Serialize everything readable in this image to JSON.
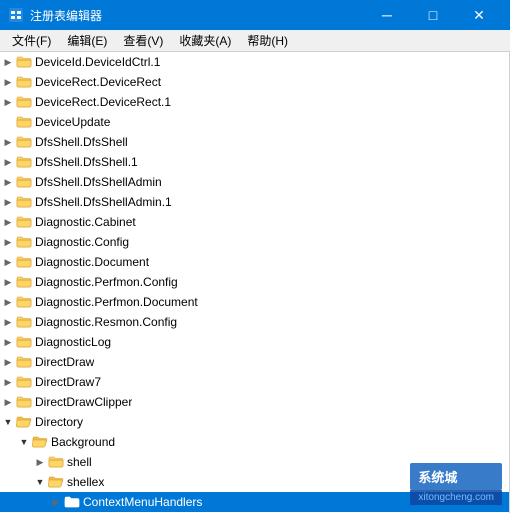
{
  "titleBar": {
    "title": "注册表编辑器",
    "icon": "regedit",
    "controls": [
      "minimize",
      "maximize",
      "close"
    ]
  },
  "menuBar": {
    "items": [
      {
        "id": "file",
        "label": "文件(F)"
      },
      {
        "id": "edit",
        "label": "编辑(E)"
      },
      {
        "id": "view",
        "label": "查看(V)"
      },
      {
        "id": "favorites",
        "label": "收藏夹(A)"
      },
      {
        "id": "help",
        "label": "帮助(H)"
      }
    ]
  },
  "tree": {
    "items": [
      {
        "id": "1",
        "label": "DeviceId.DeviceIdCtrl.1",
        "indent": 1,
        "expanded": false,
        "open": false
      },
      {
        "id": "2",
        "label": "DeviceRect.DeviceRect",
        "indent": 1,
        "expanded": false,
        "open": false
      },
      {
        "id": "3",
        "label": "DeviceRect.DeviceRect.1",
        "indent": 1,
        "expanded": false,
        "open": false
      },
      {
        "id": "4",
        "label": "DeviceUpdate",
        "indent": 1,
        "expanded": false,
        "open": false,
        "noExpand": true
      },
      {
        "id": "5",
        "label": "DfsShell.DfsShell",
        "indent": 1,
        "expanded": false,
        "open": false
      },
      {
        "id": "6",
        "label": "DfsShell.DfsShell.1",
        "indent": 1,
        "expanded": false,
        "open": false
      },
      {
        "id": "7",
        "label": "DfsShell.DfsShellAdmin",
        "indent": 1,
        "expanded": false,
        "open": false
      },
      {
        "id": "8",
        "label": "DfsShell.DfsShellAdmin.1",
        "indent": 1,
        "expanded": false,
        "open": false
      },
      {
        "id": "9",
        "label": "Diagnostic.Cabinet",
        "indent": 1,
        "expanded": false,
        "open": false
      },
      {
        "id": "10",
        "label": "Diagnostic.Config",
        "indent": 1,
        "expanded": false,
        "open": false
      },
      {
        "id": "11",
        "label": "Diagnostic.Document",
        "indent": 1,
        "expanded": false,
        "open": false
      },
      {
        "id": "12",
        "label": "Diagnostic.Perfmon.Config",
        "indent": 1,
        "expanded": false,
        "open": false
      },
      {
        "id": "13",
        "label": "Diagnostic.Perfmon.Document",
        "indent": 1,
        "expanded": false,
        "open": false
      },
      {
        "id": "14",
        "label": "Diagnostic.Resmon.Config",
        "indent": 1,
        "expanded": false,
        "open": false
      },
      {
        "id": "15",
        "label": "DiagnosticLog",
        "indent": 1,
        "expanded": false,
        "open": false
      },
      {
        "id": "16",
        "label": "DirectDraw",
        "indent": 1,
        "expanded": false,
        "open": false
      },
      {
        "id": "17",
        "label": "DirectDraw7",
        "indent": 1,
        "expanded": false,
        "open": false
      },
      {
        "id": "18",
        "label": "DirectDrawClipper",
        "indent": 1,
        "expanded": false,
        "open": false
      },
      {
        "id": "19",
        "label": "Directory",
        "indent": 1,
        "expanded": true,
        "open": true
      },
      {
        "id": "20",
        "label": "Background",
        "indent": 2,
        "expanded": true,
        "open": true
      },
      {
        "id": "21",
        "label": "shell",
        "indent": 3,
        "expanded": false,
        "open": false
      },
      {
        "id": "22",
        "label": "shellex",
        "indent": 3,
        "expanded": true,
        "open": true
      },
      {
        "id": "23",
        "label": "ContextMenuHandlers",
        "indent": 4,
        "expanded": false,
        "open": false,
        "selected": true
      }
    ]
  },
  "watermark": {
    "site": "系统城",
    "url": "xitongcheng.com"
  }
}
